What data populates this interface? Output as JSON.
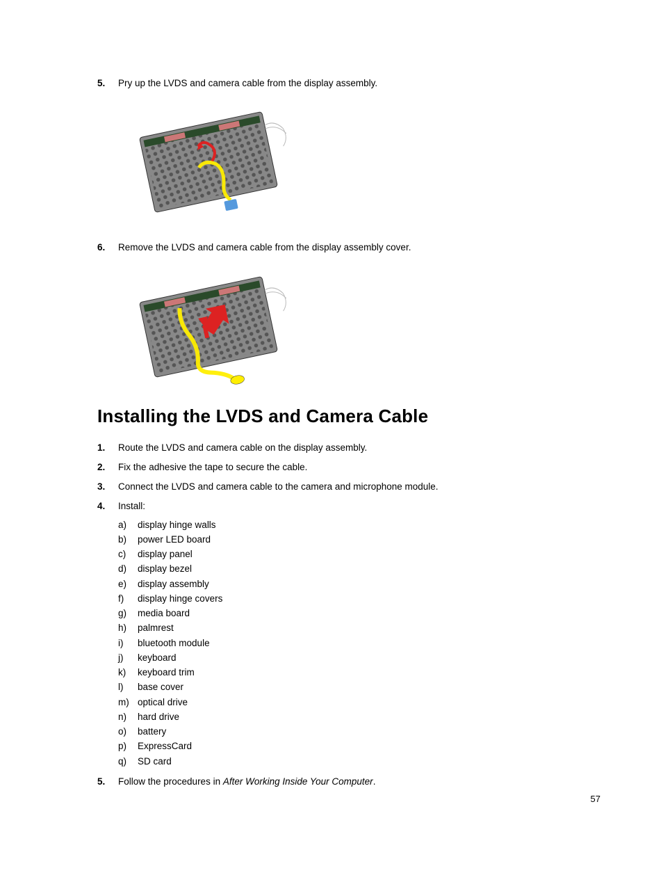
{
  "steps_before": [
    {
      "num": "5.",
      "text": "Pry up the LVDS and camera cable from the display assembly."
    },
    {
      "num": "6.",
      "text": "Remove the LVDS and camera cable from the display assembly cover."
    }
  ],
  "heading": "Installing the LVDS and Camera Cable",
  "steps_after": [
    {
      "num": "1.",
      "text": "Route the LVDS and camera cable on the display assembly."
    },
    {
      "num": "2.",
      "text": "Fix the adhesive the tape to secure the cable."
    },
    {
      "num": "3.",
      "text": "Connect the LVDS and camera cable to the camera and microphone module."
    },
    {
      "num": "4.",
      "text": "Install:"
    },
    {
      "num": "5.",
      "text_prefix": "Follow the procedures in ",
      "text_italic": "After Working Inside Your Computer",
      "text_suffix": "."
    }
  ],
  "install_sub": [
    {
      "letter": "a)",
      "text": "display hinge walls"
    },
    {
      "letter": "b)",
      "text": "power LED board"
    },
    {
      "letter": "c)",
      "text": "display panel"
    },
    {
      "letter": "d)",
      "text": "display bezel"
    },
    {
      "letter": "e)",
      "text": "display assembly"
    },
    {
      "letter": "f)",
      "text": "display hinge covers"
    },
    {
      "letter": "g)",
      "text": "media board"
    },
    {
      "letter": "h)",
      "text": "palmrest"
    },
    {
      "letter": "i)",
      "text": "bluetooth module"
    },
    {
      "letter": "j)",
      "text": "keyboard"
    },
    {
      "letter": "k)",
      "text": "keyboard trim"
    },
    {
      "letter": "l)",
      "text": "base cover"
    },
    {
      "letter": "m)",
      "text": "optical drive"
    },
    {
      "letter": "n)",
      "text": "hard drive"
    },
    {
      "letter": "o)",
      "text": "battery"
    },
    {
      "letter": "p)",
      "text": "ExpressCard"
    },
    {
      "letter": "q)",
      "text": "SD card"
    }
  ],
  "page_number": "57"
}
